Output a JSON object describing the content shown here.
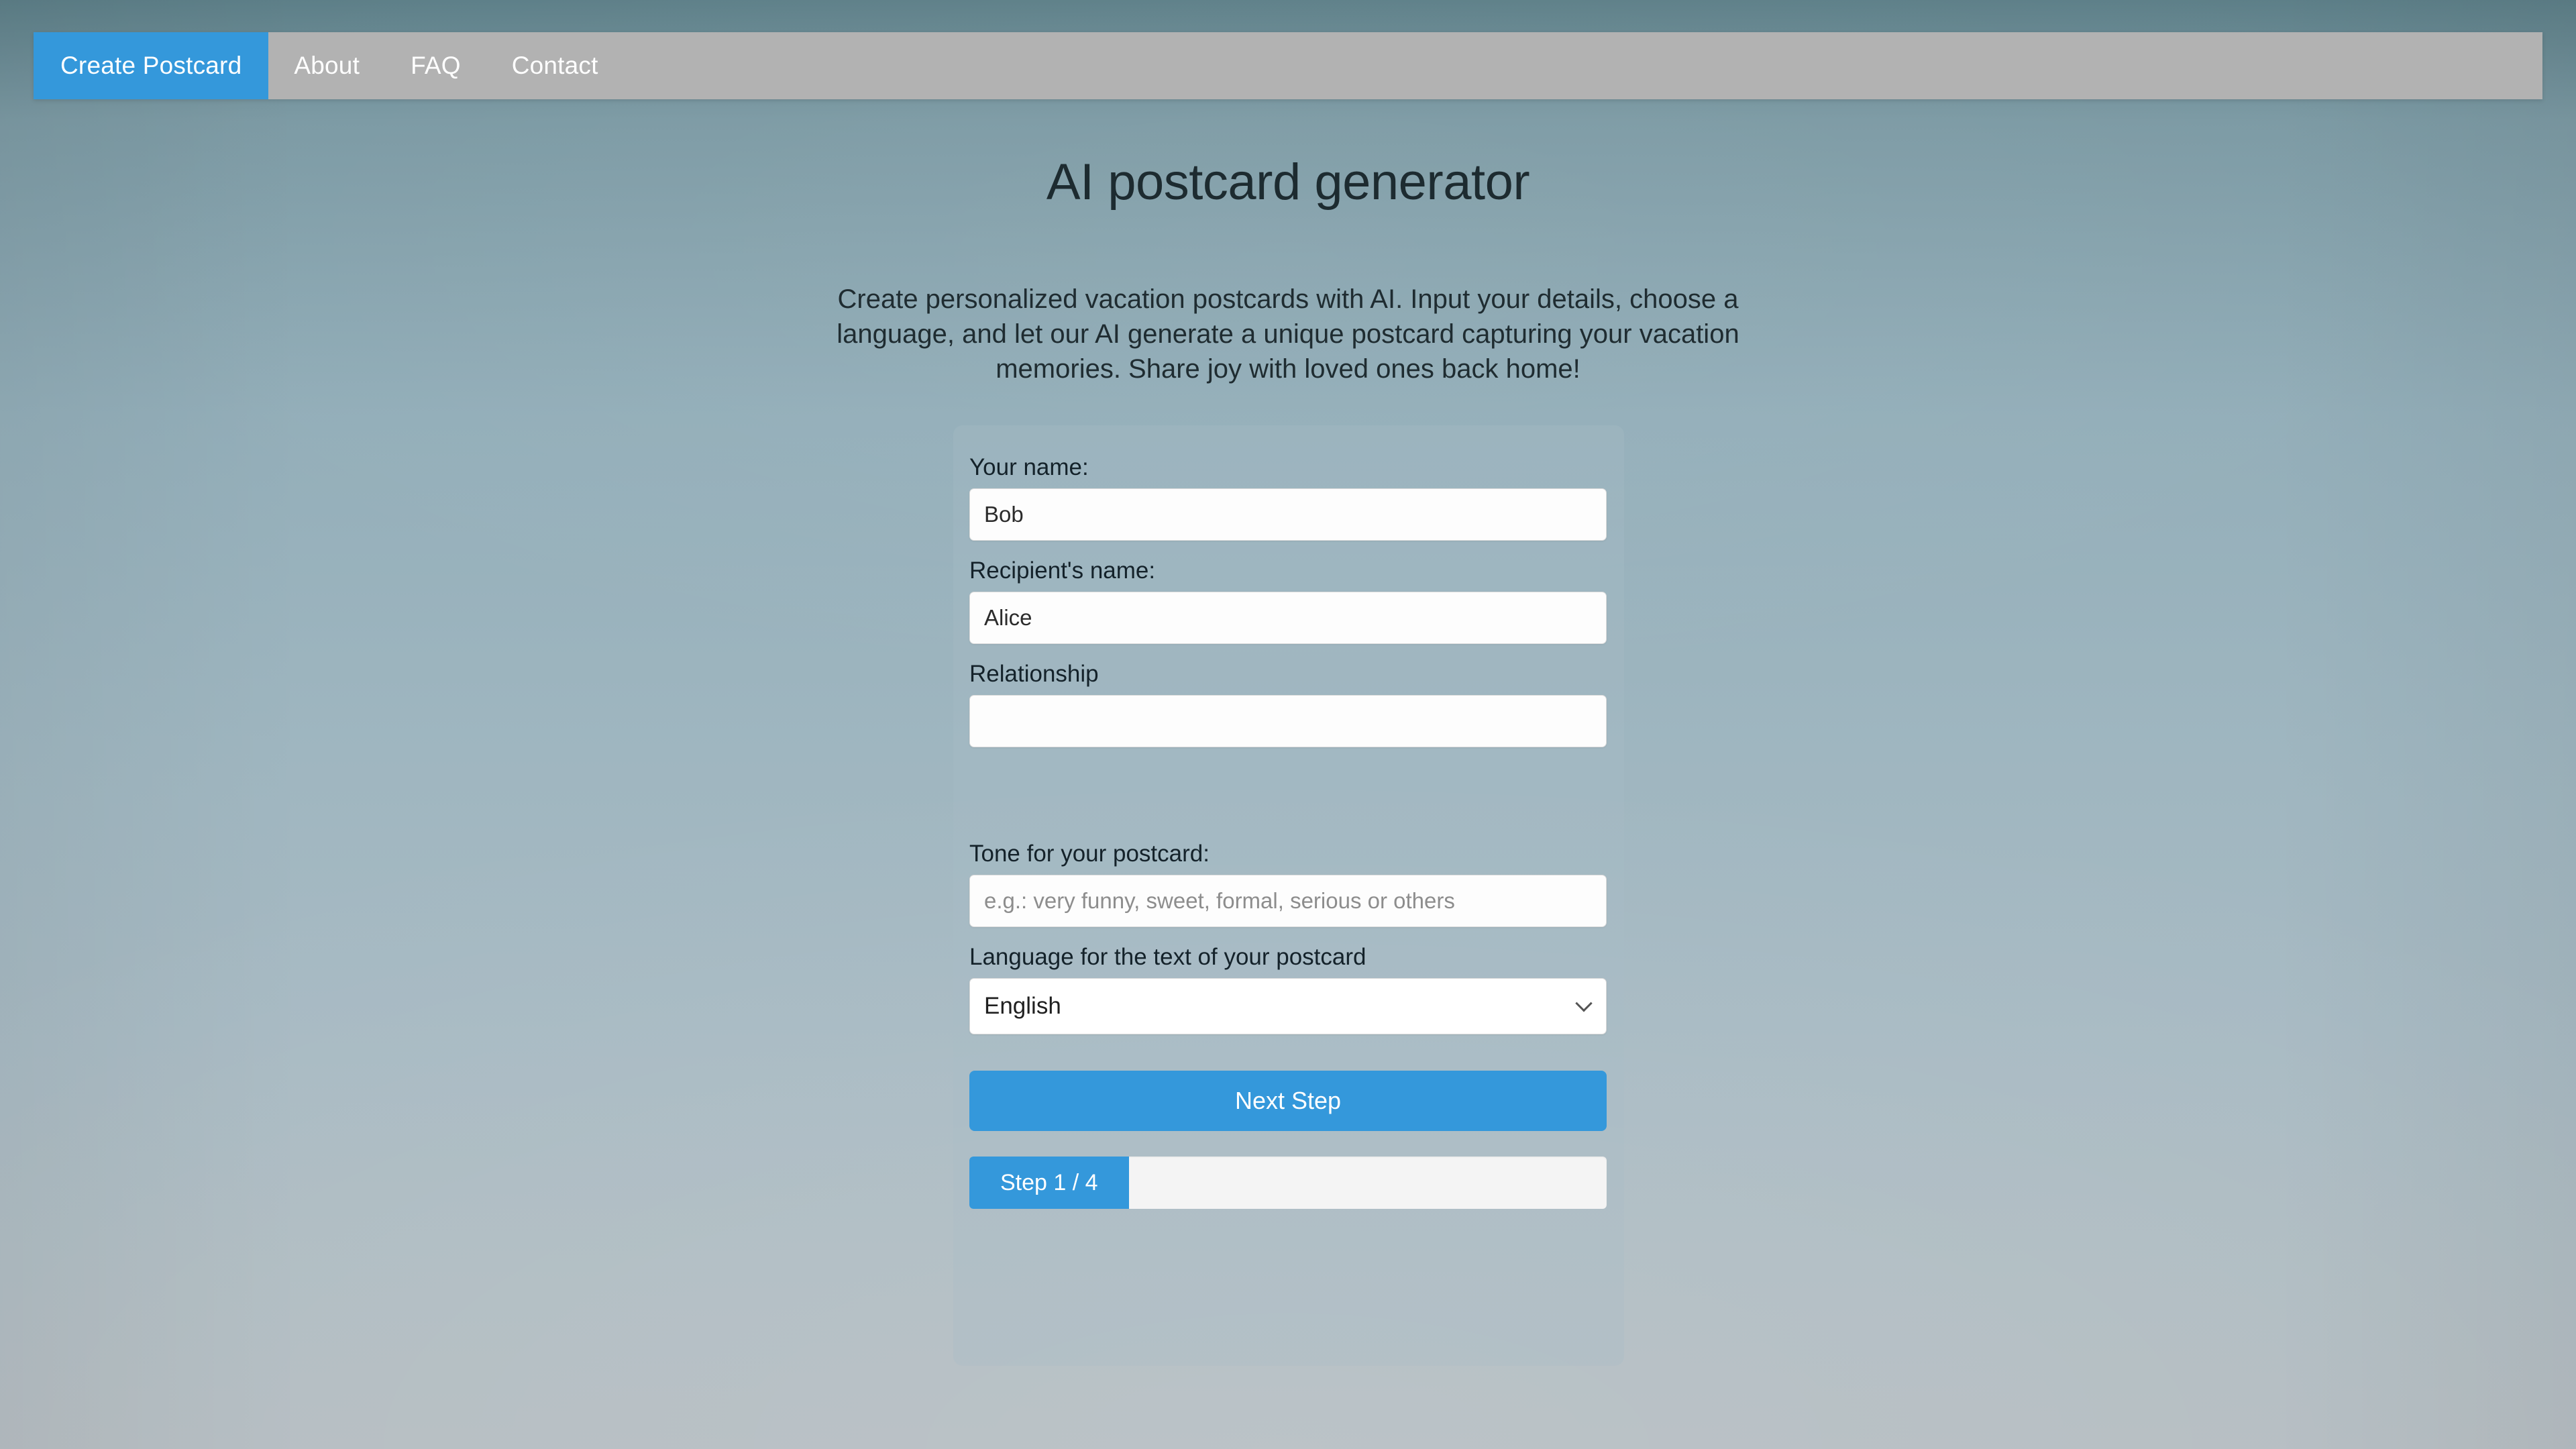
{
  "navbar": {
    "items": [
      {
        "label": "Create Postcard",
        "active": true
      },
      {
        "label": "About",
        "active": false
      },
      {
        "label": "FAQ",
        "active": false
      },
      {
        "label": "Contact",
        "active": false
      }
    ]
  },
  "header": {
    "title": "AI postcard generator",
    "subtitle": "Create personalized vacation postcards with AI. Input your details, choose a language, and let our AI generate a unique postcard capturing your vacation memories. Share joy with loved ones back home!"
  },
  "form": {
    "your_name": {
      "label": "Your name:",
      "value": "Bob",
      "placeholder": ""
    },
    "recipient_name": {
      "label": "Recipient's name:",
      "value": "Alice",
      "placeholder": ""
    },
    "relationship": {
      "label": "Relationship",
      "value": "",
      "placeholder": ""
    },
    "tone": {
      "label": "Tone for your postcard:",
      "value": "",
      "placeholder": "e.g.: very funny, sweet, formal, serious or others"
    },
    "language": {
      "label": "Language for the text of your postcard",
      "selected": "English",
      "options": [
        "English"
      ],
      "icon": "chevron-down-icon"
    },
    "next_button": "Next Step",
    "progress": {
      "label": "Step 1 / 4",
      "current_step": 1,
      "total_steps": 4,
      "percent": 25
    }
  },
  "colors": {
    "accent": "#3498db",
    "navbar_bg": "#b2b2b2",
    "card_bg": "#aabec6",
    "input_bg": "#ffffff",
    "text_dark": "#1d2b30",
    "text_light": "#ffffff"
  }
}
